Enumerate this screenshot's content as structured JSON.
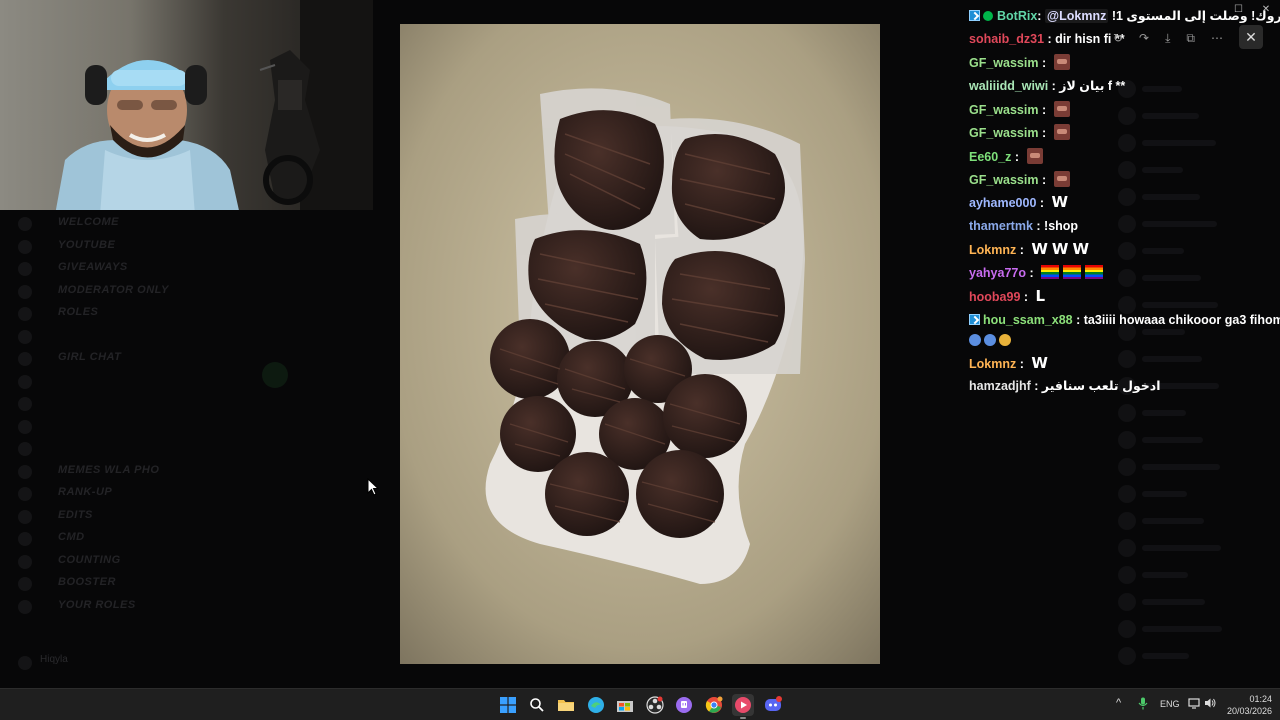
{
  "chat": {
    "messages": [
      {
        "user": "BotRix",
        "color": "#61d6a8",
        "badges": [
          "prime",
          "verified"
        ],
        "sep": ": ",
        "mention": "@Lokmnz",
        "text": " !مبروك! وصلت إلى المستوى 1"
      },
      {
        "user": "sohaib_dz31",
        "color": "#e0485a",
        "sep": " : ",
        "text": "dir hisn fi **"
      },
      {
        "user": "GF_wassim",
        "color": "#9be08c",
        "sep": " : ",
        "emotes": [
          "face"
        ]
      },
      {
        "user": "waliiidd_wiwi",
        "color": "#a9e6b6",
        "sep": " : ",
        "text": "بيان لاز f **"
      },
      {
        "user": "GF_wassim",
        "color": "#9be08c",
        "sep": " : ",
        "emotes": [
          "face"
        ]
      },
      {
        "user": "GF_wassim",
        "color": "#9be08c",
        "sep": " : ",
        "emotes": [
          "face"
        ]
      },
      {
        "user": "Ee60_z",
        "color": "#7ee07a",
        "sep": " : ",
        "emotes": [
          "face"
        ]
      },
      {
        "user": "GF_wassim",
        "color": "#9be08c",
        "sep": " : ",
        "emotes": [
          "face"
        ]
      },
      {
        "user": "ayhame000",
        "color": "#9fb8ff",
        "sep": " : ",
        "emotes": [
          "W"
        ]
      },
      {
        "user": "thamertmk",
        "color": "#8aa8e8",
        "sep": " : ",
        "text": "!shop"
      },
      {
        "user": "Lokmnz",
        "color": "#ffb454",
        "sep": " : ",
        "emotes": [
          "W",
          "W",
          "W"
        ]
      },
      {
        "user": "yahya77o",
        "color": "#c86cf0",
        "sep": " : ",
        "emotes": [
          "flag",
          "flag",
          "flag"
        ]
      },
      {
        "user": "hooba99",
        "color": "#e0485a",
        "sep": " : ",
        "emotes": [
          "L"
        ]
      },
      {
        "user": "hou_ssam_x88",
        "color": "#8ce07a",
        "badges": [
          "prime"
        ],
        "sep": " : ",
        "text": "ta3iiii howaaa chikooor ga3 fihom"
      },
      {
        "user": "",
        "color": "#ffffff",
        "sep": "",
        "reactions": [
          "#5b8ee0",
          "#5b8ee0",
          "#e8b23a"
        ]
      },
      {
        "user": "Lokmnz",
        "color": "#ffb454",
        "sep": " : ",
        "emotes": [
          "W"
        ]
      },
      {
        "user": "hamzadjhf",
        "color": "#e6e6e6",
        "sep": " : ",
        "text": "ادخول تلعب سنافير"
      }
    ]
  },
  "viewer_toolbar": {
    "icons": [
      "rotate-icon",
      "share-icon",
      "download-icon",
      "open-external-icon",
      "more-icon"
    ],
    "close_label": "✕"
  },
  "window_controls": {
    "restore": "☐",
    "close": "✕"
  },
  "background": {
    "channels": [
      "WELCOME",
      "YOUTUBE",
      "GIVEAWAYS",
      "MODERATOR ONLY",
      "ROLES",
      "",
      "GIRL CHAT",
      "",
      "",
      "",
      "",
      "MEMES WLA PHO",
      "RANK-UP",
      "EDITS",
      "CMD",
      "COUNTING",
      "BOOSTER",
      "YOUR ROLES"
    ],
    "user_name": "Hiqyla"
  },
  "taskbar": {
    "apps": [
      {
        "name": "windows-start-icon",
        "color": "#3aa0ff"
      },
      {
        "name": "search-icon",
        "color": "#ffffff"
      },
      {
        "name": "file-explorer-icon",
        "color": "#f2c14e"
      },
      {
        "name": "edge-icon",
        "color": "#2fb0e8"
      },
      {
        "name": "store-icon",
        "color": "#c9c9c9"
      },
      {
        "name": "obs-icon",
        "color": "#dddddd"
      },
      {
        "name": "twitch-app-icon",
        "color": "#9b6cf0"
      },
      {
        "name": "chrome-icon",
        "color": "#e84a3a"
      },
      {
        "name": "media-player-icon",
        "color": "#e84a6a"
      },
      {
        "name": "discord-icon",
        "color": "#5865f2"
      }
    ],
    "tray": {
      "lang": "ENG",
      "time": "01:24",
      "date": "20/03/2026"
    }
  }
}
